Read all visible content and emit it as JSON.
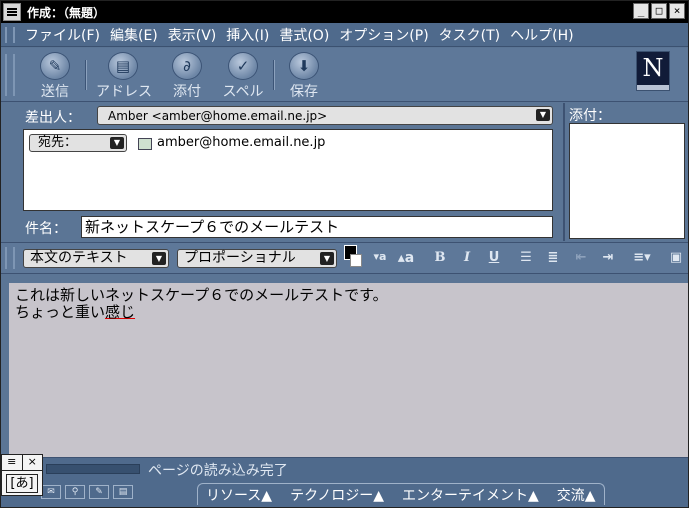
{
  "window": {
    "title": "作成：（無題）"
  },
  "menu": [
    "ファイル(F)",
    "編集(E)",
    "表示(V)",
    "挿入(I)",
    "書式(O)",
    "オプション(P)",
    "タスク(T)",
    "ヘルプ(H)"
  ],
  "toolbar": {
    "send": "送信",
    "address": "アドレス",
    "attach": "添付",
    "spell": "スペル",
    "save": "保存",
    "logo": "N"
  },
  "header": {
    "from_label": "差出人：",
    "from_value": "Amber <amber@home.email.ne.jp>",
    "to_label": "宛先：",
    "to_address": "amber@home.email.ne.jp",
    "subject_label": "件名：",
    "subject_value": "新ネットスケープ６でのメールテスト",
    "attach_label": "添付："
  },
  "format": {
    "style": "本文のテキスト",
    "font": "プロポーショナル",
    "bold": "B",
    "italic": "I",
    "underline": "U"
  },
  "body": {
    "line1": "これは新しいネットスケープ６でのメールテストです。",
    "line2_a": "ちょっと重い",
    "line2_b": "感じ"
  },
  "status": {
    "text": "ページの読み込み完了",
    "tabs": [
      "リソース▲",
      "テクノロジー▲",
      "エンターテイメント▲",
      "交流▲"
    ]
  },
  "ime": {
    "mode": "[あ]"
  }
}
